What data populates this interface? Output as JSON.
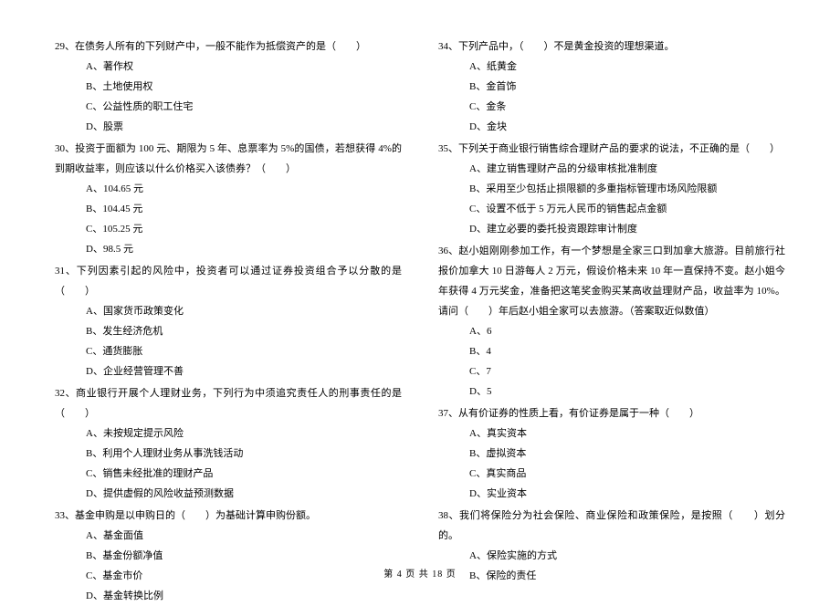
{
  "left_column": {
    "q29": {
      "text": "29、在债务人所有的下列财产中，一般不能作为抵偿资产的是（　　）",
      "options": {
        "a": "A、著作权",
        "b": "B、土地使用权",
        "c": "C、公益性质的职工住宅",
        "d": "D、股票"
      }
    },
    "q30": {
      "text": "30、投资于面额为 100 元、期限为 5 年、息票率为 5%的国债，若想获得 4%的到期收益率，则应该以什么价格买入该债券？（　　）",
      "options": {
        "a": "A、104.65 元",
        "b": "B、104.45 元",
        "c": "C、105.25 元",
        "d": "D、98.5 元"
      }
    },
    "q31": {
      "text": "31、下列因素引起的风险中，投资者可以通过证券投资组合予以分散的是（　　）",
      "options": {
        "a": "A、国家货币政策变化",
        "b": "B、发生经济危机",
        "c": "C、通货膨胀",
        "d": "D、企业经营管理不善"
      }
    },
    "q32": {
      "text": "32、商业银行开展个人理财业务，下列行为中须追究责任人的刑事责任的是（　　）",
      "options": {
        "a": "A、未按规定提示风险",
        "b": "B、利用个人理财业务从事洗钱活动",
        "c": "C、销售未经批准的理财产品",
        "d": "D、提供虚假的风险收益预测数据"
      }
    },
    "q33": {
      "text": "33、基金申购是以申购日的（　　）为基础计算申购份额。",
      "options": {
        "a": "A、基金面值",
        "b": "B、基金份额净值",
        "c": "C、基金市价",
        "d": "D、基金转换比例"
      }
    }
  },
  "right_column": {
    "q34": {
      "text": "34、下列产品中，（　　）不是黄金投资的理想渠道。",
      "options": {
        "a": "A、纸黄金",
        "b": "B、金首饰",
        "c": "C、金条",
        "d": "D、金块"
      }
    },
    "q35": {
      "text": "35、下列关于商业银行销售综合理财产品的要求的说法，不正确的是（　　）",
      "options": {
        "a": "A、建立销售理财产品的分级审核批准制度",
        "b": "B、采用至少包括止损限额的多重指标管理市场风险限额",
        "c": "C、设置不低于 5 万元人民币的销售起点金额",
        "d": "D、建立必要的委托投资跟踪审计制度"
      }
    },
    "q36": {
      "text": "36、赵小姐刚刚参加工作，有一个梦想是全家三口到加拿大旅游。目前旅行社报价加拿大 10 日游每人 2 万元，假设价格未来 10 年一直保持不变。赵小姐今年获得 4 万元奖金，准备把这笔奖金购买某高收益理财产品，收益率为 10%。请问（　　）年后赵小姐全家可以去旅游。（答案取近似数值）",
      "options": {
        "a": "A、6",
        "b": "B、4",
        "c": "C、7",
        "d": "D、5"
      }
    },
    "q37": {
      "text": "37、从有价证券的性质上看，有价证券是属于一种（　　）",
      "options": {
        "a": "A、真实资本",
        "b": "B、虚拟资本",
        "c": "C、真实商品",
        "d": "D、实业资本"
      }
    },
    "q38": {
      "text": "38、我们将保险分为社会保险、商业保险和政策保险，是按照（　　）划分的。",
      "options": {
        "a": "A、保险实施的方式",
        "b": "B、保险的责任"
      }
    }
  },
  "footer": "第 4 页 共 18 页"
}
